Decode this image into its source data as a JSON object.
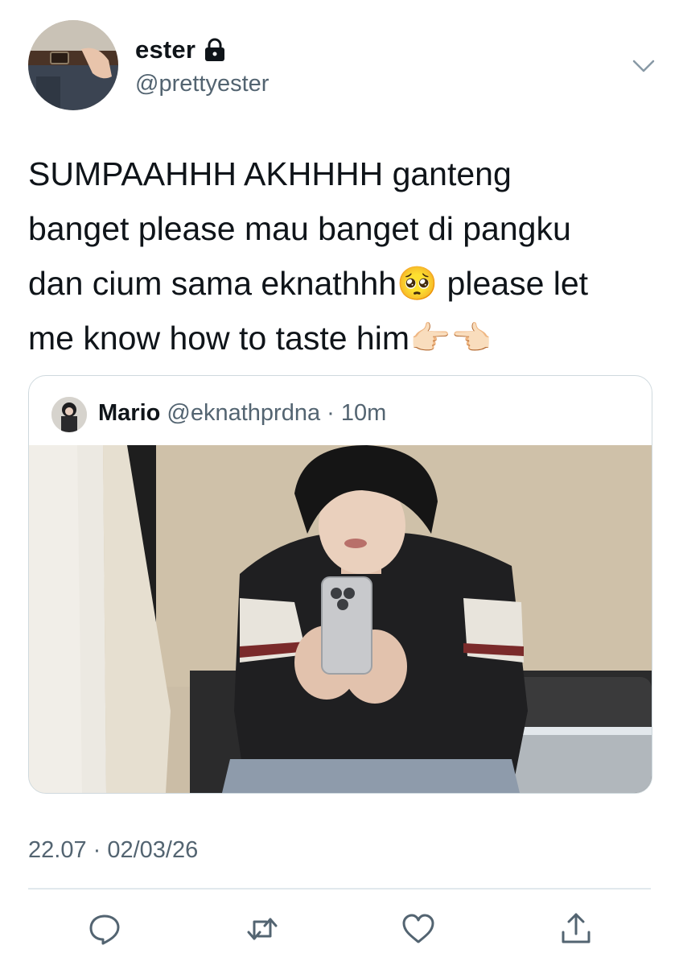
{
  "author": {
    "display_name": "ester",
    "handle": "@prettyester",
    "protected": true
  },
  "tweet": {
    "lines": [
      "SUMPAAHHH AKHHHH ganteng",
      "banget please mau banget di pangku",
      "dan cium sama eknathhh🥺 please let",
      "me know how to taste him👉🏻👈🏻"
    ]
  },
  "quoted_tweet": {
    "display_name": "Mario",
    "handle": "@eknathprdna",
    "time": "· 10m"
  },
  "meta": {
    "timestamp": "22.07 · 02/03/26"
  },
  "icons": {
    "lock": "lock-icon",
    "menu": "chevron-down-icon",
    "reply": "reply-icon",
    "retweet": "retweet-icon",
    "like": "heart-icon",
    "share": "share-icon"
  },
  "colors": {
    "text_primary": "#0f1419",
    "text_secondary": "#536471",
    "border": "#cfd9de"
  }
}
